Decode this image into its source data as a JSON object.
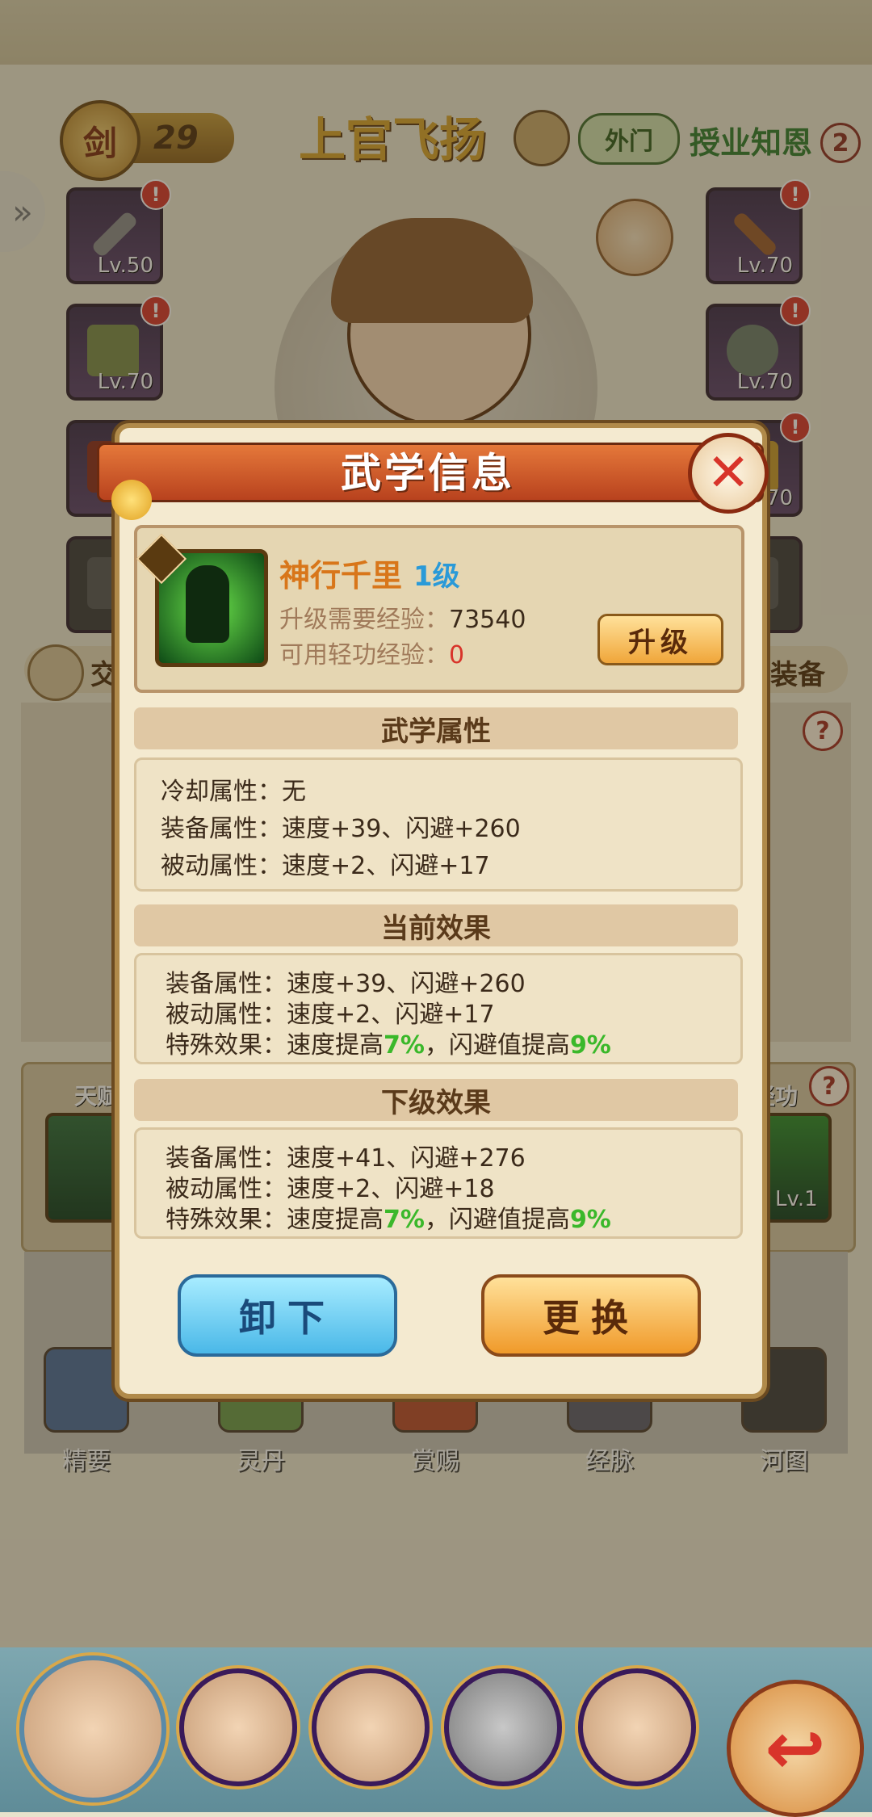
{
  "header": {
    "rank_badge": "剑",
    "rank_number": "29",
    "hero_name": "上官飞扬",
    "sect": "外门",
    "title": "授业知恩",
    "title_count": "2"
  },
  "equipment_left": [
    {
      "level": "Lv.50",
      "alert": "!",
      "icon": "sword-icon",
      "color": "#8a8a8a"
    },
    {
      "level": "Lv.70",
      "alert": "!",
      "icon": "robe-icon",
      "color": "#7a8a4a"
    },
    {
      "level": "",
      "alert": "!",
      "icon": "helmet-icon",
      "color": "#8a2a1a"
    },
    {
      "level": "",
      "alert": "",
      "icon": "lock-icon",
      "color": "#444444"
    }
  ],
  "equipment_right": [
    {
      "level": "Lv.70",
      "alert": "!",
      "icon": "staff-icon",
      "color": "#9a5a2a"
    },
    {
      "level": "Lv.70",
      "alert": "!",
      "icon": "bracelet-icon",
      "color": "#6a7a6a"
    },
    {
      "level": "70",
      "alert": "!",
      "icon": "armor-icon",
      "color": "#c89a2a"
    },
    {
      "level": "",
      "alert": "",
      "icon": "lock-icon",
      "color": "#444444"
    }
  ],
  "underlay": {
    "exchange_label": "交",
    "onekey_label": "键装备",
    "talent_label": "天赋",
    "qinggong_label": "轻功",
    "qinggong_level": "Lv.1",
    "help": "?",
    "features": [
      "精要",
      "灵丹",
      "赏赐",
      "经脉",
      "河图"
    ]
  },
  "dialog": {
    "title": "武学信息",
    "close": "✕",
    "skill": {
      "name": "神行千里",
      "level": "1级",
      "exp_label": "升级需要经验：",
      "exp_value": "73540",
      "avail_label": "可用轻功经验：",
      "avail_value": "0",
      "upgrade_button": "升级"
    },
    "attributes": {
      "header": "武学属性",
      "cooldown_label": "冷却属性：",
      "cooldown_value": "无",
      "equip_label": "装备属性：",
      "equip_value": "速度+39、闪避+260",
      "passive_label": "被动属性：",
      "passive_value": "速度+2、闪避+17"
    },
    "current_effect": {
      "header": "当前效果",
      "equip_label": "装备属性：",
      "equip_value": "速度+39、闪避+260",
      "passive_label": "被动属性：",
      "passive_value": "速度+2、闪避+17",
      "special_label": "特殊效果：",
      "special_pre": "速度提高",
      "special_pct1": "7%",
      "special_mid": "，闪避值提高",
      "special_pct2": "9%"
    },
    "next_effect": {
      "header": "下级效果",
      "equip_label": "装备属性：",
      "equip_value": "速度+41、闪避+276",
      "passive_label": "被动属性：",
      "passive_value": "速度+2、闪避+18",
      "special_label": "特殊效果：",
      "special_pre": "速度提高",
      "special_pct1": "7%",
      "special_mid": "，闪避值提高",
      "special_pct2": "9%"
    },
    "unload_button": "卸下",
    "replace_button": "更换"
  },
  "bottom": {
    "back_icon": "↩"
  }
}
